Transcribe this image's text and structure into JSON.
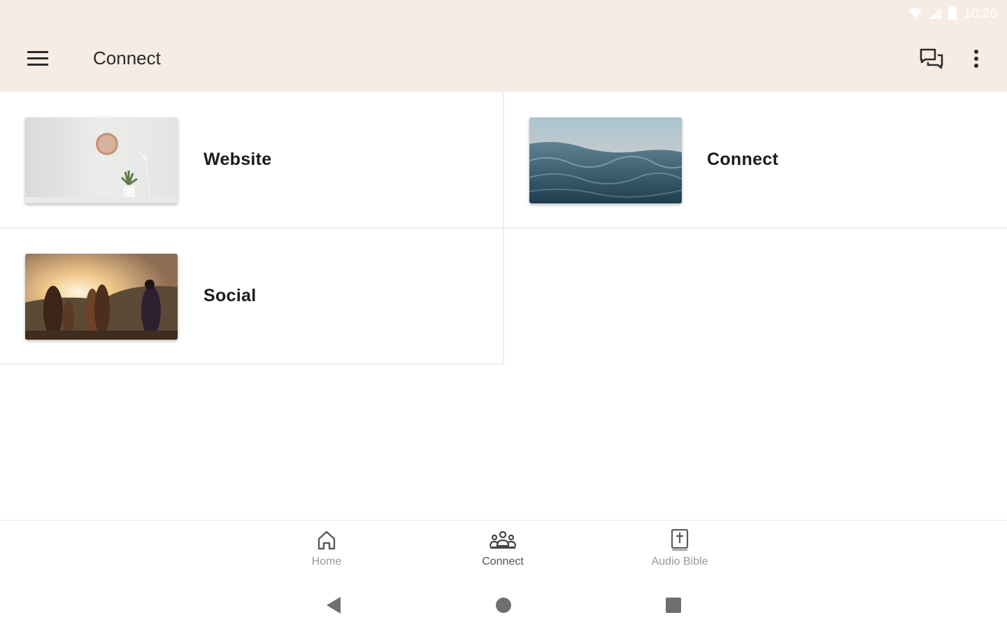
{
  "status_bar": {
    "time": "10:26",
    "icons": [
      "wifi-icon",
      "signal-icon",
      "battery-icon"
    ]
  },
  "app_bar": {
    "title": "Connect",
    "left_icon": "menu-icon",
    "right_icons": [
      "chat-icon",
      "more-vert-icon"
    ]
  },
  "cards": [
    {
      "label": "Website",
      "image": "white-wall-clock-plant-photo"
    },
    {
      "label": "Connect",
      "image": "ocean-waves-photo"
    },
    {
      "label": "Social",
      "image": "friends-sunset-hill-photo"
    }
  ],
  "bottom_nav": {
    "items": [
      {
        "label": "Home",
        "icon": "home-icon",
        "active": false
      },
      {
        "label": "Connect",
        "icon": "group-icon",
        "active": true
      },
      {
        "label": "Audio Bible",
        "icon": "bible-icon",
        "active": false
      }
    ]
  },
  "system_nav": {
    "buttons": [
      "back-icon",
      "home-circle-icon",
      "recents-icon"
    ]
  },
  "colors": {
    "app_bar_bg": "#f6ece3",
    "divider": "#eeeeee",
    "inactive_nav": "#9a9a9a",
    "active_nav": "#555555"
  }
}
